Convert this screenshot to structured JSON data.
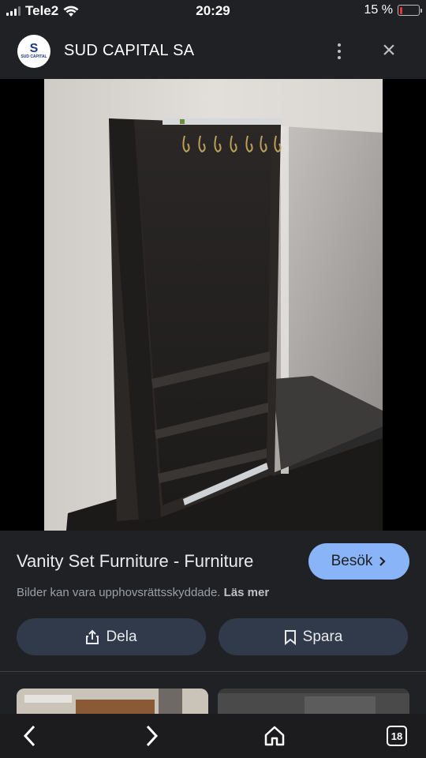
{
  "status_bar": {
    "carrier": "Tele2",
    "time": "20:29",
    "battery": "15 %",
    "battery_level": 0.15
  },
  "header": {
    "logo_text": "SUD CAPITAL",
    "site_name": "SUD CAPITAL SA"
  },
  "result": {
    "title": "Vanity Set Furniture - Furniture",
    "visit_label": "Besök",
    "copyright_text": "Bilder kan vara upphovsrättsskyddade.",
    "learn_more": "Läs mer"
  },
  "actions": {
    "share_label": "Dela",
    "save_label": "Spara"
  },
  "nav": {
    "tabs_count": "18"
  },
  "colors": {
    "background": "#202124",
    "accent": "#8ab4f8",
    "button_bg": "#303a4a"
  }
}
